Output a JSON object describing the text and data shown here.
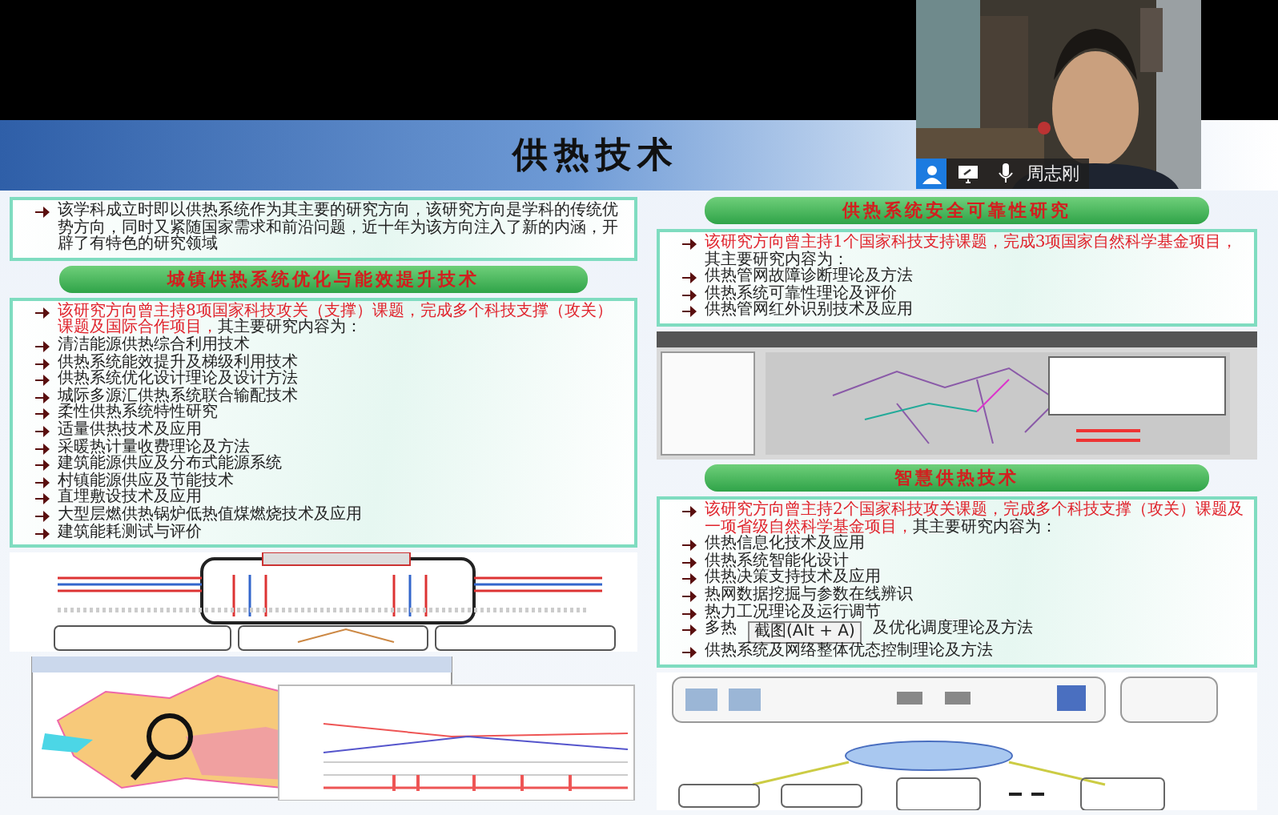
{
  "camera": {
    "name": "周志刚"
  },
  "slide": {
    "title": "供热技术",
    "intro": "该学科成立时即以供热系统作为其主要的研究方向，该研究方向是学科的传统优势方向，同时又紧随国家需求和前沿问题，近十年为该方向注入了新的内涵，开辟了有特色的研究领域",
    "left_sections": [
      {
        "heading": "城镇供热系统优化与能效提升技术",
        "highlight": "该研究方向曾主持8项国家科技攻关（支撑）课题，完成多个科技支撑（攻关）课题及国际合作项目，",
        "lead": "其主要研究内容为：",
        "items": [
          {
            "kind": "text",
            "text": "清洁能源供热综合利用技术"
          },
          {
            "kind": "text",
            "text": "供热系统能效提升及梯级利用技术"
          },
          {
            "kind": "text",
            "text": "供热系统优化设计理论及设计方法"
          },
          {
            "kind": "text",
            "text": "城际多源汇供热系统联合输配技术"
          },
          {
            "kind": "text",
            "text": "柔性供热系统特性研究"
          },
          {
            "kind": "text",
            "text": "适量供热技术及应用"
          },
          {
            "kind": "text",
            "text": "采暖热计量收费理论及方法"
          },
          {
            "kind": "text",
            "text": "建筑能源供应及分布式能源系统"
          },
          {
            "kind": "text",
            "text": "村镇能源供应及节能技术"
          },
          {
            "kind": "text",
            "text": "直埋敷设技术及应用"
          },
          {
            "kind": "text",
            "text": "大型层燃供热锅炉低热值煤燃烧技术及应用"
          },
          {
            "kind": "text",
            "text": "建筑能耗测试与评价"
          }
        ]
      }
    ],
    "right_sections": [
      {
        "heading": "供热系统安全可靠性研究",
        "highlight": "该研究方向曾主持1个国家科技支持课题，完成3项国家自然科学基金项目，",
        "lead": "其主要研究内容为：",
        "items": [
          {
            "kind": "text",
            "text": "供热管网故障诊断理论及方法"
          },
          {
            "kind": "text",
            "text": "供热系统可靠性理论及评价"
          },
          {
            "kind": "text",
            "text": "供热管网红外识别技术及应用"
          }
        ]
      },
      {
        "heading": "智慧供热技术",
        "highlight": "该研究方向曾主持2个国家科技攻关课题，完成多个科技支撑（攻关）课题及一项省级自然科学基金项目，",
        "lead": "其主要研究内容为：",
        "items": [
          {
            "kind": "text",
            "text": "供热信息化技术及应用"
          },
          {
            "kind": "text",
            "text": "供热系统智能化设计"
          },
          {
            "kind": "text",
            "text": "供热决策支持技术及应用"
          },
          {
            "kind": "text",
            "text": "热网数据挖掘与参数在线辨识"
          },
          {
            "kind": "text",
            "text": "热力工况理论及运行调节"
          },
          {
            "kind": "covered",
            "parts": [
              "多热",
              "及优化调度理论及方法"
            ]
          },
          {
            "kind": "text",
            "text": "供热系统及网络整体优态控制理论及方法"
          }
        ]
      }
    ]
  },
  "tooltip": "截图(Alt + A)"
}
